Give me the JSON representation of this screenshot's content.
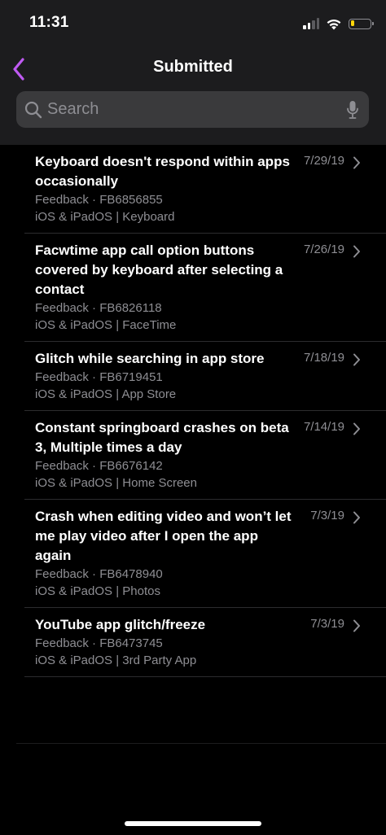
{
  "status_bar": {
    "time": "11:31",
    "battery_level": 0.2,
    "battery_color": "#ffd60a"
  },
  "nav": {
    "title": "Submitted",
    "accent_color": "#bf5af2"
  },
  "search": {
    "placeholder": "Search"
  },
  "items": [
    {
      "title": "Keyboard doesn't respond within apps occasionally",
      "feedback": "Feedback · FB6856855",
      "category": "iOS & iPadOS | Keyboard",
      "date": "7/29/19"
    },
    {
      "title": "Facwtime app call option buttons covered by keyboard after selecting a contact",
      "feedback": "Feedback · FB6826118",
      "category": "iOS & iPadOS | FaceTime",
      "date": "7/26/19"
    },
    {
      "title": "Glitch while searching in app store",
      "feedback": "Feedback · FB6719451",
      "category": "iOS & iPadOS | App Store",
      "date": "7/18/19"
    },
    {
      "title": "Constant springboard crashes on beta 3, Multiple times a day",
      "feedback": "Feedback · FB6676142",
      "category": "iOS & iPadOS | Home Screen",
      "date": "7/14/19"
    },
    {
      "title": "Crash when editing video and won’t let me play video after I open the app again",
      "feedback": "Feedback · FB6478940",
      "category": "iOS & iPadOS | Photos",
      "date": "7/3/19"
    },
    {
      "title": "YouTube app glitch/freeze",
      "feedback": "Feedback · FB6473745",
      "category": "iOS & iPadOS | 3rd Party App",
      "date": "7/3/19"
    }
  ]
}
